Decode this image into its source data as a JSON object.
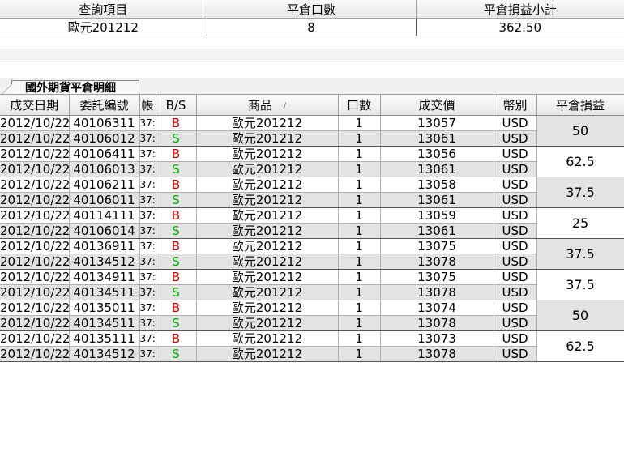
{
  "summary": {
    "headers": [
      "查詢項目",
      "平倉口數",
      "平倉損益小計"
    ],
    "row": {
      "item": "歐元201212",
      "qty": "8",
      "subtotal": "362.50"
    }
  },
  "tab_label": "國外期貨平倉明細",
  "detail": {
    "headers": {
      "date": "成交日期",
      "order": "委託編號",
      "account": "帳",
      "bs": "B/S",
      "product": "商品",
      "lots": "口數",
      "price": "成交價",
      "currency": "幣別",
      "pnl": "平倉損益"
    },
    "pairs": [
      {
        "pnl": "50",
        "rows": [
          {
            "date": "2012/10/22",
            "order": "40106311",
            "acct": "37:",
            "bs": "B",
            "product": "歐元201212",
            "lots": "1",
            "price": "13057",
            "ccy": "USD"
          },
          {
            "date": "2012/10/22",
            "order": "40106012",
            "acct": "37:",
            "bs": "S",
            "product": "歐元201212",
            "lots": "1",
            "price": "13061",
            "ccy": "USD"
          }
        ]
      },
      {
        "pnl": "62.5",
        "rows": [
          {
            "date": "2012/10/22",
            "order": "40106411",
            "acct": "37:",
            "bs": "B",
            "product": "歐元201212",
            "lots": "1",
            "price": "13056",
            "ccy": "USD"
          },
          {
            "date": "2012/10/22",
            "order": "40106013",
            "acct": "37:",
            "bs": "S",
            "product": "歐元201212",
            "lots": "1",
            "price": "13061",
            "ccy": "USD"
          }
        ]
      },
      {
        "pnl": "37.5",
        "rows": [
          {
            "date": "2012/10/22",
            "order": "40106211",
            "acct": "37:",
            "bs": "B",
            "product": "歐元201212",
            "lots": "1",
            "price": "13058",
            "ccy": "USD"
          },
          {
            "date": "2012/10/22",
            "order": "40106011",
            "acct": "37:",
            "bs": "S",
            "product": "歐元201212",
            "lots": "1",
            "price": "13061",
            "ccy": "USD"
          }
        ]
      },
      {
        "pnl": "25",
        "rows": [
          {
            "date": "2012/10/22",
            "order": "40114111",
            "acct": "37:",
            "bs": "B",
            "product": "歐元201212",
            "lots": "1",
            "price": "13059",
            "ccy": "USD"
          },
          {
            "date": "2012/10/22",
            "order": "40106014",
            "acct": "37:",
            "bs": "S",
            "product": "歐元201212",
            "lots": "1",
            "price": "13061",
            "ccy": "USD"
          }
        ]
      },
      {
        "pnl": "37.5",
        "rows": [
          {
            "date": "2012/10/22",
            "order": "40136911",
            "acct": "37:",
            "bs": "B",
            "product": "歐元201212",
            "lots": "1",
            "price": "13075",
            "ccy": "USD"
          },
          {
            "date": "2012/10/22",
            "order": "40134512",
            "acct": "37:",
            "bs": "S",
            "product": "歐元201212",
            "lots": "1",
            "price": "13078",
            "ccy": "USD"
          }
        ]
      },
      {
        "pnl": "37.5",
        "rows": [
          {
            "date": "2012/10/22",
            "order": "40134911",
            "acct": "37:",
            "bs": "B",
            "product": "歐元201212",
            "lots": "1",
            "price": "13075",
            "ccy": "USD"
          },
          {
            "date": "2012/10/22",
            "order": "40134511",
            "acct": "37:",
            "bs": "S",
            "product": "歐元201212",
            "lots": "1",
            "price": "13078",
            "ccy": "USD"
          }
        ]
      },
      {
        "pnl": "50",
        "rows": [
          {
            "date": "2012/10/22",
            "order": "40135011",
            "acct": "37:",
            "bs": "B",
            "product": "歐元201212",
            "lots": "1",
            "price": "13074",
            "ccy": "USD"
          },
          {
            "date": "2012/10/22",
            "order": "40134511",
            "acct": "37:",
            "bs": "S",
            "product": "歐元201212",
            "lots": "1",
            "price": "13078",
            "ccy": "USD"
          }
        ]
      },
      {
        "pnl": "62.5",
        "rows": [
          {
            "date": "2012/10/22",
            "order": "40135111",
            "acct": "37:",
            "bs": "B",
            "product": "歐元201212",
            "lots": "1",
            "price": "13073",
            "ccy": "USD"
          },
          {
            "date": "2012/10/22",
            "order": "40134512",
            "acct": "37:",
            "bs": "S",
            "product": "歐元201212",
            "lots": "1",
            "price": "13078",
            "ccy": "USD"
          }
        ]
      }
    ]
  },
  "colors": {
    "buy": "#e00000",
    "sell": "#00b000",
    "shade": "#e3e3e3"
  },
  "icons": {
    "sort": "sort-ascending-icon"
  }
}
